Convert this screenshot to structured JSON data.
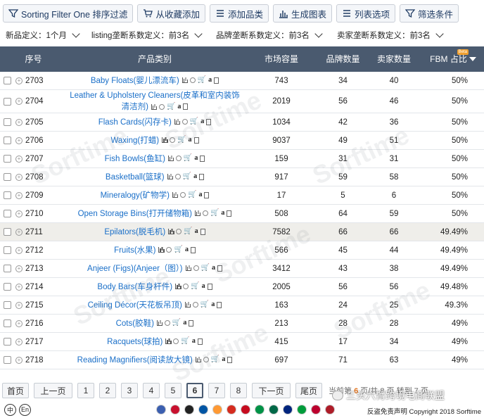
{
  "toolbar": {
    "sorting_filter": "Sorting Filter One 排序过滤",
    "add_from_favorites": "从收藏添加",
    "add_category": "添加品类",
    "generate_chart": "生成图表",
    "list_options": "列表选项",
    "filter_conditions": "筛选条件"
  },
  "filters": {
    "new_def": "新品定义：1个月",
    "listing_def": "listing垄断系数定义：前3名",
    "brand_def": "品牌垄断系数定义：前3名",
    "seller_def": "卖家垄断系数定义：前3名"
  },
  "table": {
    "headers": {
      "seq": "序号",
      "category": "产品类别",
      "market": "市场容量",
      "brands": "品牌数量",
      "sellers": "卖家数量",
      "fbm": "FBM 占比",
      "beta": "Beta"
    },
    "rows": [
      {
        "num": "2703",
        "name": "Baby Floats(婴儿漂流车)",
        "market": "743",
        "brands": "34",
        "sellers": "40",
        "fbm": "50%"
      },
      {
        "num": "2704",
        "name": "Leather & Upholstery Cleaners(皮革和室内装饰清洁剂)",
        "market": "2019",
        "brands": "56",
        "sellers": "46",
        "fbm": "50%"
      },
      {
        "num": "2705",
        "name": "Flash Cards(闪存卡)",
        "market": "1034",
        "brands": "42",
        "sellers": "36",
        "fbm": "50%"
      },
      {
        "num": "2706",
        "name": "Waxing(打蜡)",
        "market": "9037",
        "brands": "49",
        "sellers": "51",
        "fbm": "50%"
      },
      {
        "num": "2707",
        "name": "Fish Bowls(鱼缸)",
        "market": "159",
        "brands": "31",
        "sellers": "31",
        "fbm": "50%"
      },
      {
        "num": "2708",
        "name": "Basketball(篮球)",
        "market": "917",
        "brands": "59",
        "sellers": "58",
        "fbm": "50%"
      },
      {
        "num": "2709",
        "name": "Mineralogy(矿物学)",
        "market": "17",
        "brands": "5",
        "sellers": "6",
        "fbm": "50%"
      },
      {
        "num": "2710",
        "name": "Open Storage Bins(打开储物箱)",
        "market": "508",
        "brands": "64",
        "sellers": "59",
        "fbm": "50%"
      },
      {
        "num": "2711",
        "name": "Epilators(脱毛机)",
        "market": "7582",
        "brands": "66",
        "sellers": "66",
        "fbm": "49.49%"
      },
      {
        "num": "2712",
        "name": "Fruits(水果)",
        "market": "566",
        "brands": "45",
        "sellers": "44",
        "fbm": "49.49%"
      },
      {
        "num": "2713",
        "name": "Anjeer (Figs)(Anjeer（图）)",
        "market": "3412",
        "brands": "43",
        "sellers": "38",
        "fbm": "49.49%"
      },
      {
        "num": "2714",
        "name": "Body Bars(车身杆件)",
        "market": "2005",
        "brands": "56",
        "sellers": "56",
        "fbm": "49.48%"
      },
      {
        "num": "2715",
        "name": "Ceiling Décor(天花板吊顶)",
        "market": "163",
        "brands": "24",
        "sellers": "25",
        "fbm": "49.3%"
      },
      {
        "num": "2716",
        "name": "Cots(胶鞋)",
        "market": "213",
        "brands": "28",
        "sellers": "28",
        "fbm": "49%"
      },
      {
        "num": "2717",
        "name": "Racquets(球拍)",
        "market": "415",
        "brands": "17",
        "sellers": "34",
        "fbm": "49%"
      },
      {
        "num": "2718",
        "name": "Reading Magnifiers(阅读放大镜)",
        "market": "697",
        "brands": "71",
        "sellers": "63",
        "fbm": "49%"
      }
    ]
  },
  "watermark": "Sorftime",
  "pager": {
    "first": "首页",
    "prev": "上一页",
    "pages": [
      "1",
      "2",
      "3",
      "4",
      "5",
      "6",
      "7",
      "8"
    ],
    "current": "6",
    "next": "下一页",
    "last": "尾页",
    "info_prefix": "当前第",
    "current_page": "6",
    "info_mid": "页/共 8 页 转到",
    "goto": "7",
    "info_suffix": "页"
  },
  "bottom": {
    "lang_zh": "中",
    "lang_en": "En",
    "copyright": "反盗免责声明 Copyright 2018 Sorftime"
  },
  "overlay_text": "三头六臂跨境电商联盟",
  "flag_colors": [
    "#3b5fb0",
    "#c8102e",
    "#222222",
    "#0055a4",
    "#ff9933",
    "#d52b1e",
    "#c60b1e",
    "#009246",
    "#006847",
    "#00247d",
    "#009c3b",
    "#bc002d",
    "#ae1c28"
  ]
}
